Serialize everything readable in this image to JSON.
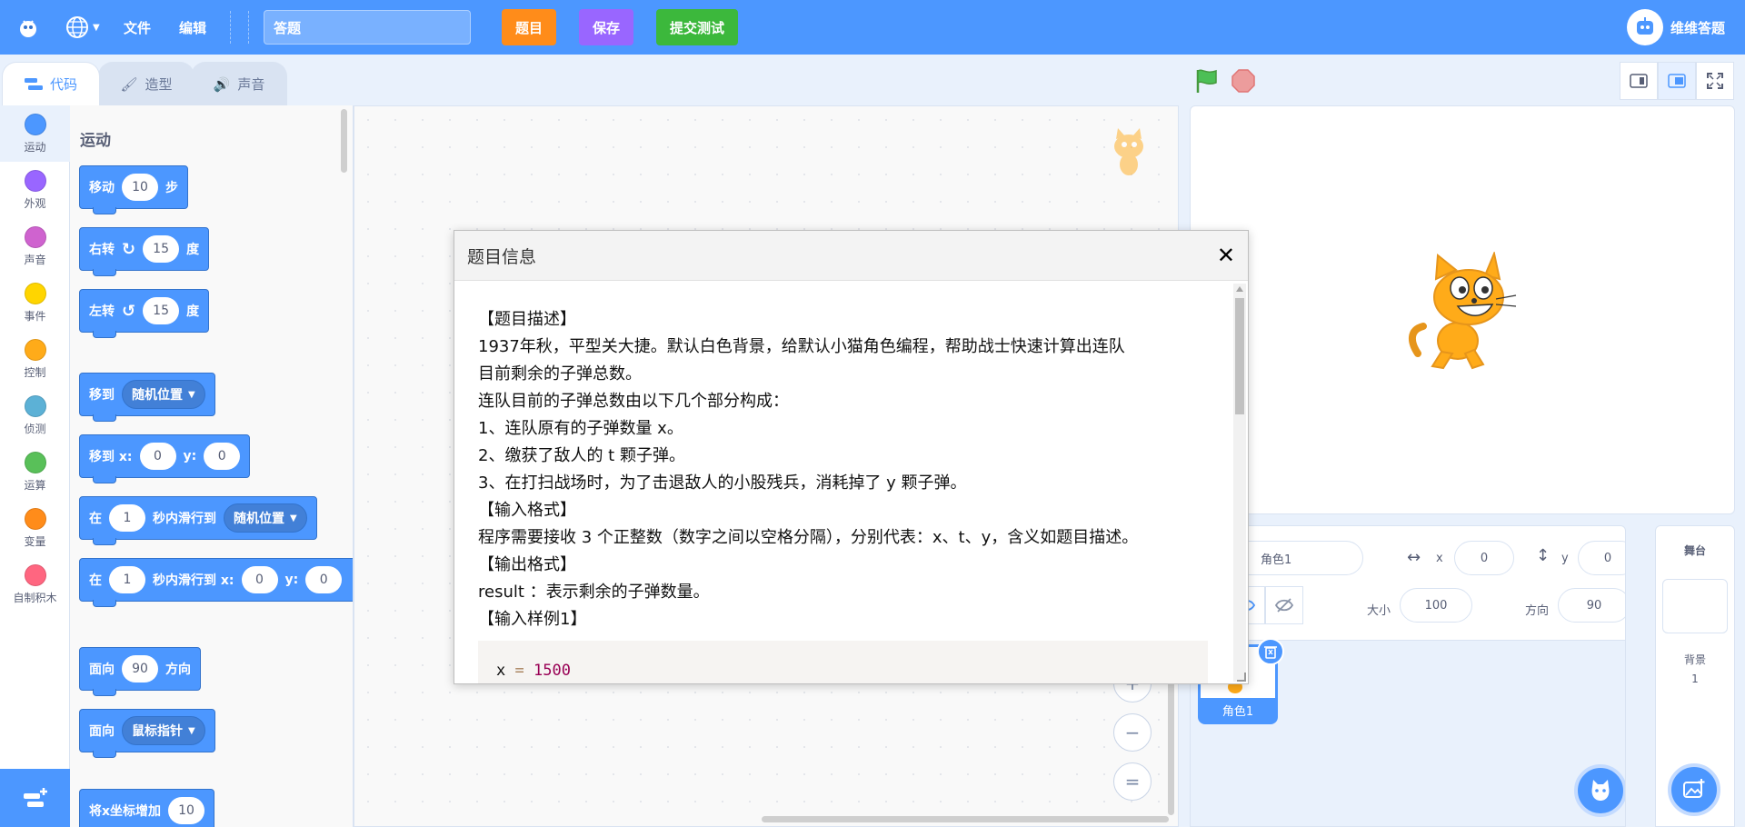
{
  "menu": {
    "file": "文件",
    "edit": "编辑",
    "project_title": "答题",
    "btn_question": "题目",
    "btn_save": "保存",
    "btn_submit": "提交测试",
    "user_name": "维维答题",
    "colors": {
      "question": "#ff8c1a",
      "save": "#9966ff",
      "submit": "#3cb83c",
      "primary": "#4c97ff"
    }
  },
  "tabs": [
    {
      "label": "代码"
    },
    {
      "label": "造型"
    },
    {
      "label": "声音"
    }
  ],
  "categories": [
    {
      "label": "运动",
      "color": "#4c97ff"
    },
    {
      "label": "外观",
      "color": "#9966ff"
    },
    {
      "label": "声音",
      "color": "#cf63cf"
    },
    {
      "label": "事件",
      "color": "#ffd500"
    },
    {
      "label": "控制",
      "color": "#ffab19"
    },
    {
      "label": "侦测",
      "color": "#5cb1d6"
    },
    {
      "label": "运算",
      "color": "#59c059"
    },
    {
      "label": "变量",
      "color": "#ff8c1a"
    },
    {
      "label": "自制积木",
      "color": "#ff6680"
    }
  ],
  "palette": {
    "heading": "运动",
    "blocks": {
      "move": {
        "a": "移动",
        "v": "10",
        "b": "步"
      },
      "turn_right": {
        "a": "右转",
        "v": "15",
        "b": "度"
      },
      "turn_left": {
        "a": "左转",
        "v": "15",
        "b": "度"
      },
      "goto": {
        "a": "移到",
        "menu": "随机位置"
      },
      "goto_xy": {
        "a": "移到 x:",
        "x": "0",
        "y_label": "y:",
        "y": "0"
      },
      "glide": {
        "a": "在",
        "v": "1",
        "b": "秒内滑行到",
        "menu": "随机位置"
      },
      "glide_xy": {
        "a": "在",
        "v": "1",
        "b": "秒内滑行到 x:",
        "x": "0",
        "y_label": "y:",
        "y": "0"
      },
      "point_dir": {
        "a": "面向",
        "v": "90",
        "b": "方向"
      },
      "point_towards": {
        "a": "面向",
        "menu": "鼠标指针"
      },
      "change_x": {
        "a": "将x坐标增加",
        "v": "10"
      }
    }
  },
  "sprite_info": {
    "name": "角色1",
    "x_label": "x",
    "x": "0",
    "y_label": "y",
    "y": "0",
    "size_label": "大小",
    "size": "100",
    "dir_label": "方向",
    "dir": "90"
  },
  "sprites": [
    {
      "name": "角色1"
    }
  ],
  "stage_pane": {
    "header": "舞台",
    "backdrop_label": "背景",
    "backdrop_count": "1"
  },
  "modal": {
    "title": "题目信息",
    "close": "✕",
    "lines": [
      "【题目描述】",
      "1937年秋，平型关大捷。默认白色背景，给默认小猫角色编程，帮助战士快速计算出连队",
      "目前剩余的子弹总数。",
      "连队目前的子弹总数由以下几个部分构成：",
      "1、连队原有的子弹数量 x。",
      "2、缴获了敌人的 t 颗子弹。",
      "3、在打扫战场时，为了击退敌人的小股残兵，消耗掉了 y 颗子弹。",
      "【输入格式】",
      "程序需要接收 3 个正整数（数字之间以空格分隔），分别代表：x、t、y，含义如题目描述。",
      "【输出格式】",
      "result ：表示剩余的子弹数量。",
      "【输入样例1】"
    ],
    "code": {
      "var": "x",
      "op": "=",
      "val": "1500"
    }
  },
  "zoom": {
    "in": "+",
    "out": "−",
    "reset": "="
  }
}
